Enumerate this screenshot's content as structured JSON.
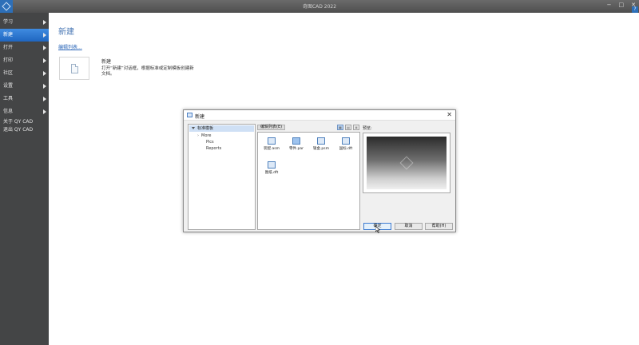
{
  "window": {
    "title": "奇图CAD 2022",
    "controls": [
      "−",
      "□",
      "✕"
    ],
    "help": "?"
  },
  "sidebar": {
    "items": [
      {
        "label": "学习",
        "arrow": true,
        "active": false
      },
      {
        "label": "新建",
        "arrow": true,
        "active": true
      },
      {
        "label": "打开",
        "arrow": true,
        "active": false
      },
      {
        "label": "打印",
        "arrow": true,
        "active": false
      },
      {
        "label": "社区",
        "arrow": true,
        "active": false
      },
      {
        "label": "设置",
        "arrow": true,
        "active": false
      },
      {
        "label": "工具",
        "arrow": true,
        "active": false
      },
      {
        "label": "信息",
        "arrow": true,
        "active": false
      }
    ],
    "plain_items": [
      {
        "label": "关于 QY CAD"
      },
      {
        "label": "退出 QY CAD"
      }
    ]
  },
  "main": {
    "title": "新建",
    "template_link": "编辑列表...",
    "card": {
      "title": "新建",
      "description": "打开“新建”对话框，根据标准或定制模板创建新文档。"
    }
  },
  "dialog": {
    "title": "新建",
    "close": "✕",
    "tree": {
      "root": "标准模板",
      "children": [
        {
          "label": "More",
          "expandable": true
        },
        {
          "label": "Pics",
          "expandable": false
        },
        {
          "label": "Reports",
          "expandable": false
        }
      ]
    },
    "list_tab": "编辑列表(E)",
    "view_buttons": [
      "▦",
      "▤",
      "≣"
    ],
    "files": [
      {
        "name": "装配.asm",
        "selected": false
      },
      {
        "name": "零件.par",
        "selected": true
      },
      {
        "name": "钣金.psm",
        "selected": false
      },
      {
        "name": "国标.dft",
        "selected": false
      },
      {
        "name": "图纸.dft",
        "selected": false
      }
    ],
    "preview_label": "预览:",
    "buttons": {
      "ok": "确定",
      "cancel": "取消",
      "help": "帮助(H)"
    }
  },
  "colors": {
    "sidebar_bg": "#444546",
    "accent": "#1f66c0",
    "title_text": "#4a78b5"
  }
}
